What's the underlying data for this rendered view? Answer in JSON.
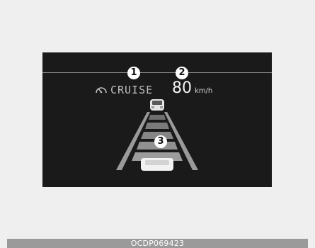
{
  "display": {
    "callouts": {
      "one": "1",
      "two": "2",
      "three": "3"
    },
    "cruise": {
      "label": "CRUISE",
      "icon": "speedometer-icon"
    },
    "speed": {
      "value": "80",
      "unit": "km/h"
    },
    "icons": {
      "lead_vehicle": "car-front-icon",
      "own_vehicle": "car-icon"
    }
  },
  "footer": {
    "code": "OCDP069423"
  },
  "colors": {
    "screen_background": "#1a1a1a",
    "page_background": "#efefef",
    "lane_stripe": "#8a8a8a",
    "footer_bar": "#9a9a9a"
  }
}
